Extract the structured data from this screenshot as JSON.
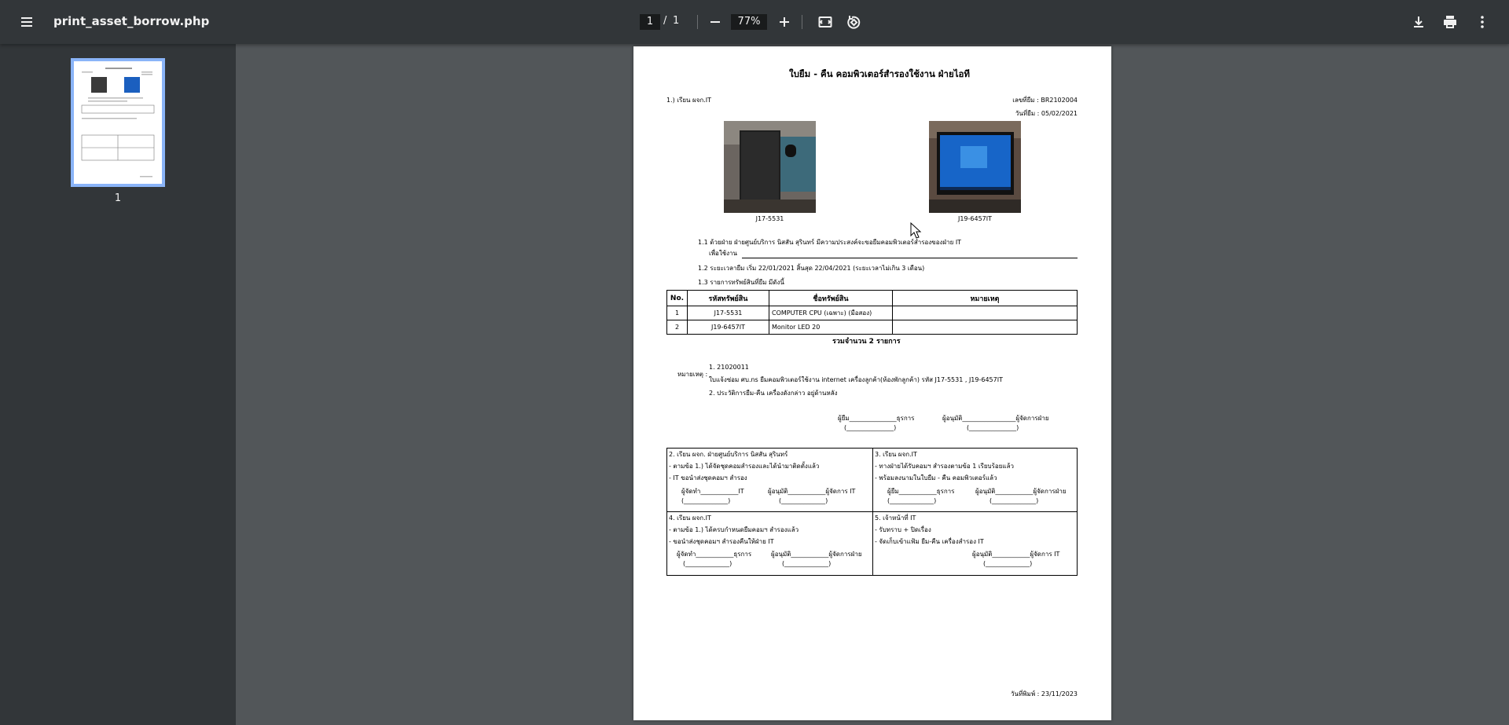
{
  "toolbar": {
    "menu_icon": "menu-icon",
    "file_name": "print_asset_borrow.php",
    "page_current": "1",
    "page_separator": "/",
    "page_total": "1",
    "zoom": "77%",
    "icons": [
      "zoom-out-icon",
      "zoom-in-icon",
      "fit-page-icon",
      "rotate-icon",
      "download-icon",
      "print-icon",
      "more-icon"
    ]
  },
  "sidebar": {
    "thumbnail_label": "1"
  },
  "document": {
    "title": "ใบยืม - คืน คอมพิวเตอร์สำรองใช้งาน ฝ่ายไอที",
    "to_line": "1.) เรียน ผจก.IT",
    "doc_no": "เลขที่ยืม : BR2102004",
    "borrow_date": "วันที่ยืม : 05/02/2021",
    "photos": [
      {
        "caption": "J17-5531"
      },
      {
        "caption": "J19-6457IT"
      }
    ],
    "section_1_1": "1.1 ด้วยฝ่าย   ฝ่ายศูนย์บริการ นิสสัน สุรินทร์   มีความประสงค์จะขอยืมคอมพิวเตอร์สำรองของฝ่าย IT",
    "section_1_1b": "เพื่อใช้งาน",
    "section_1_2": "1.2 ระยะเวลายืม เริ่ม   22/01/2021   สิ้นสุด   22/04/2021   (ระยะเวลาไม่เกิน 3 เดือน)",
    "section_1_3": "1.3 รายการทรัพย์สินที่ยืม มีดังนี้",
    "table": {
      "headers": [
        "No.",
        "รหัสทรัพย์สิน",
        "ชื่อทรัพย์สิน",
        "หมายเหตุ"
      ],
      "rows": [
        [
          "1",
          "J17-5531",
          "COMPUTER CPU (เฉพาะ) (มือสอง)",
          ""
        ],
        [
          "2",
          "J19-6457IT",
          "Monitor LED 20",
          ""
        ]
      ]
    },
    "total": "รวมจำนวน    2   รายการ",
    "remark_label": "หมายเหตุ :",
    "remarks": [
      "1. 21020011",
      "ใบแจ้งซ่อม ศบ.ns ยืมคอมพิวเตอร์ใช้งาน internet เครื่องลูกค้า(ห้องพักลูกค้า) รหัส J17-5531 , J19-6457IT",
      "2. ประวัติการยืม-คืน เครื่องดังกล่าว อยู่ด้านหลัง"
    ],
    "sign_borrower": "ผู้ยืม_______________ธุรการ",
    "sign_approver": "ผู้อนุมัติ_________________ผู้จัดการฝ่าย",
    "sign_paren_1": "(_______________)",
    "sign_paren_2": "(_______________)",
    "box2": {
      "lines": [
        "2. เรียน ผจก. ฝ่ายศูนย์บริการ นิสสัน สุรินทร์",
        "- ตามข้อ 1.) ได้จัดชุดคอมสำรองและได้นำมาติดตั้งแล้ว",
        "- IT ขอนำส่งชุดคอมฯ สำรอง"
      ],
      "sign_a": "ผู้จัดทำ____________IT",
      "sign_b": "ผู้อนุมัติ____________ผู้จัดการ IT",
      "paren_a": "(______________)",
      "paren_b": "(______________)"
    },
    "box3": {
      "lines": [
        "3. เรียน ผจก.IT",
        "- ทางฝ่ายได้รับคอมฯ สำรองตามข้อ 1 เรียบร้อยแล้ว",
        "- พร้อมลงนามในใบยืม - คืน คอมพิวเตอร์แล้ว"
      ],
      "sign_a": "ผู้ยืม____________ธุรการ",
      "sign_b": "ผู้อนุมัติ____________ผู้จัดการฝ่าย",
      "paren_a": "(______________)",
      "paren_b": "(______________)"
    },
    "box4": {
      "lines": [
        "4. เรียน ผจก.IT",
        "- ตามข้อ 1.) ได้ครบกำหนดยืมคอมฯ สำรองแล้ว",
        "- ขอนำส่งชุดคอมฯ สำรองคืนให้ฝ่าย IT"
      ],
      "sign_a": "ผู้จัดทำ____________ธุรการ",
      "sign_b": "ผู้อนุมัติ____________ผู้จัดการฝ่าย",
      "paren_a": "(______________)",
      "paren_b": "(______________)"
    },
    "box5": {
      "lines": [
        "5. เจ้าหน้าที่ IT",
        "- รับทราบ + ปิดเรื่อง",
        "- จัดเก็บเข้าแฟ้ม ยืม-คืน เครื่องสำรอง IT"
      ],
      "sign_b": "ผู้อนุมัติ____________ผู้จัดการ IT",
      "paren_b": "(______________)"
    },
    "print_date": "วันที่พิมพ์ : 23/11/2023"
  }
}
